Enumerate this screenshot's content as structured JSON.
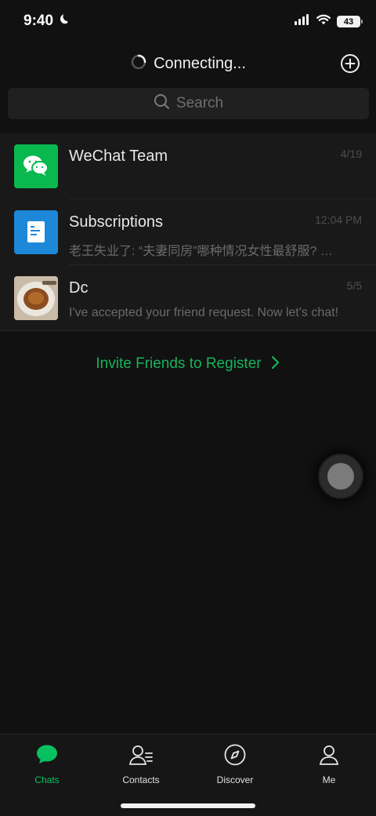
{
  "status": {
    "time": "9:40",
    "battery": "43"
  },
  "header": {
    "title": "Connecting..."
  },
  "search": {
    "placeholder": "Search"
  },
  "chats": [
    {
      "name": "WeChat Team",
      "preview": "",
      "time": "4/19"
    },
    {
      "name": "Subscriptions",
      "preview": "老王失业了: “夫妻同房”哪种情况女性最舒服? …",
      "time": "12:04 PM"
    },
    {
      "name": "Dc",
      "preview": "I've accepted your friend request. Now let's chat!",
      "time": "5/5"
    }
  ],
  "invite": {
    "label": "Invite Friends to Register"
  },
  "tabs": [
    {
      "label": "Chats"
    },
    {
      "label": "Contacts"
    },
    {
      "label": "Discover"
    },
    {
      "label": "Me"
    }
  ],
  "colors": {
    "accent": "#07c160",
    "background": "#191919"
  }
}
